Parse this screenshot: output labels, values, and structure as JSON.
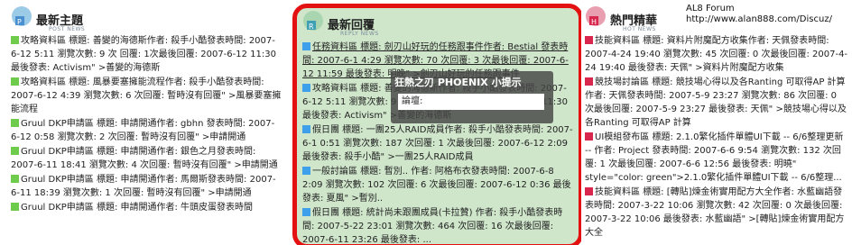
{
  "left": {
    "title": "最新主題",
    "subtitle": "POST NEWS",
    "items": [
      {
        "color": "green",
        "text": "攻略資料區 標題: 善變的海德斯作者: 殺手小酷發表時間: 2007-6-12 5:11 瀏覽次數: 9 次 回覆: 1次最後回覆: 2007-6-12 11:30 最後發表: Activism\" >善變的海德斯"
      },
      {
        "color": "green",
        "text": "攻略資料區 標題: 風暴要塞擁能流程作者: 殺手小酷發表時間: 2007-6-12 4:39 瀏覽次數: 6 次回覆: 暫時沒有回覆\" >風暴要塞擁能流程"
      },
      {
        "color": "green",
        "text": "Gruul DKP申請區 標題: 申請開通作者: gbhn 發表時間: 2007-6-12 0:58 瀏覽次數: 2 次回覆: 暫時沒有回覆\" >申請開通"
      },
      {
        "color": "green",
        "text": "Gruul DKP申請區 標題: 申請開通作者: 銀色之月發表時間: 2007-6-11 18:41 瀏覽次數: 4 次回覆: 暫時沒有回覆\" >申請開通"
      },
      {
        "color": "green",
        "text": "Gruul DKP申請區 標題: 申請開通作者: 馬爾斯發表時間: 2007-6-11 18:39 瀏覽次數: 1 次回覆: 暫時沒有回覆\" >申請開通"
      },
      {
        "color": "green",
        "text": "Gruul DKP申請區 標題: 申請開通作者: 牛頭皮蛋發表時間"
      }
    ]
  },
  "middle": {
    "title": "最新回覆",
    "subtitle": "REPLY NEWS",
    "items": [
      {
        "color": "blue",
        "link": true,
        "text": "任務資料區 標題: 劍刃山好玩的任務跟事件作者: Bestial 發表時間: 2007-6-1 4:29 瀏覽次數: 70 次回覆: 3 次最後回覆: 2007-6-12 11:59 最後發表: 明晚\" >劍刃山好玩的任務跟事件"
      },
      {
        "color": "blue",
        "link": false,
        "text": "攻略資料區 標題: 善變的海德斯作者: 殺手小酷發表時間: 2007-6-12 5:11 瀏覽次數: 9 次回覆: 1 次最後回覆: 2007-6-12 11:30 最後發表: Activism\" >善變的海德斯"
      },
      {
        "color": "blue",
        "link": false,
        "text": "假日團 標題: 一團25人RAID成員作者: 殺手小酷發表時間: 2007-6-1 0:51 瀏覽次數: 187 次回覆: 1 次最後回覆: 2007-6-12 2:09 最後發表: 殺手小酷\" >一團25人RAID成員"
      },
      {
        "color": "blue",
        "link": false,
        "text": "一般討論區 標題: 暫別.. 作者: 阿格布衣發表時間: 2007-6-8 2:09 瀏覽次數: 102 次回覆: 6 次最後回覆: 2007-6-12 0:36 最後發表: 夏風\" >暫別.."
      },
      {
        "color": "blue",
        "link": false,
        "text": "假日團 標題: 統計尚未跟團成員(卡拉贊) 作者: 殺手小酷發表時間: 2007-5-22 23:01 瀏覽次數: 464 次回覆: 16 次最後回覆: 2007-6-11 23:26 最後發表: ..."
      }
    ],
    "tooltip": {
      "title": "狂熱之刃 PHOENIX 小提示",
      "field": "論壇:"
    }
  },
  "right": {
    "title": "熱門精華",
    "subtitle": "HOT NEWS",
    "forum_name": "AL8 Forum",
    "forum_url": "http://www.alan888.com/Discuz/",
    "items": [
      {
        "color": "red",
        "text": "技能資料區 標題: 資料片附魔配方收集作者: 天佩發表時間: 2007-4-24 19:40 瀏覽次數: 45 次回覆: 0 次最後回覆: 2007-4-24 19:40 最後發表: 天佩\" >資料片附魔配方收集"
      },
      {
        "color": "red",
        "text": "競技場討論區 標題: 競技場心得以及各Ranting 可取得AP 計算作者: 天佩發表時間: 2007-5-9 23:27 瀏覽次數: 86 次回覆: 0 次最後回覆: 2007-5-9 23:27 最後發表: 天佩\" >競技場心得以及各Ranting 可取得AP 計算"
      },
      {
        "color": "red",
        "text": "UI模組發布區 標題: 2.1.0繁化插件單體UI下載 -- 6/6整理更新 -- 作者: Project 發表時間: 2007-6-6 9:54 瀏覽次數: 132 次回覆: 1 次最後回覆: 2007-6-6 12:56 最後發表: 明曉\" style=\"color: green\">2.1.0繁化插件單體UI下載 -- 6/6整理..."
      },
      {
        "color": "red",
        "text": "技能資料區 標題: [轉貼]煉金術實用配方大全作者: 水藍幽語發表時間: 2007-3-22 10:06 瀏覽次數: 42 次回覆: 0 次最後回覆: 2007-3-22 10:06 最後發表: 水藍幽語\" >[轉貼]煉金術實用配方大全"
      }
    ]
  }
}
